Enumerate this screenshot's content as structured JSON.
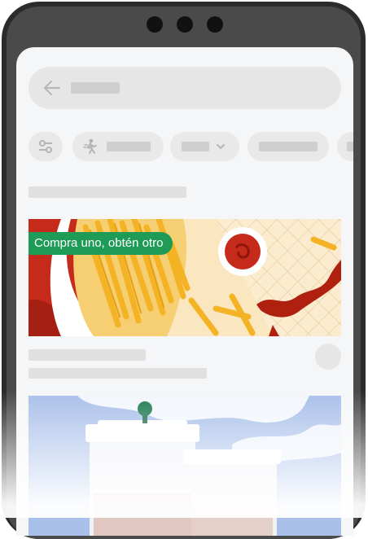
{
  "search": {
    "back_icon": "arrow-left-icon"
  },
  "filters": {
    "icons": [
      "sliders-icon",
      "walking-person-icon",
      "chevron-down-icon"
    ]
  },
  "promo_banner": {
    "badge_label": "Compra uno, obtén otro",
    "badge_color": "#1e9b57"
  },
  "colors": {
    "device_frame": "#2b2b2b",
    "screen_background": "#f5f6f7",
    "promo_green": "#1e9b57",
    "banner_red": "#c62a1b",
    "fries_yellow": "#f4b324",
    "coffee_banner_blue": "#a9c0ea"
  }
}
